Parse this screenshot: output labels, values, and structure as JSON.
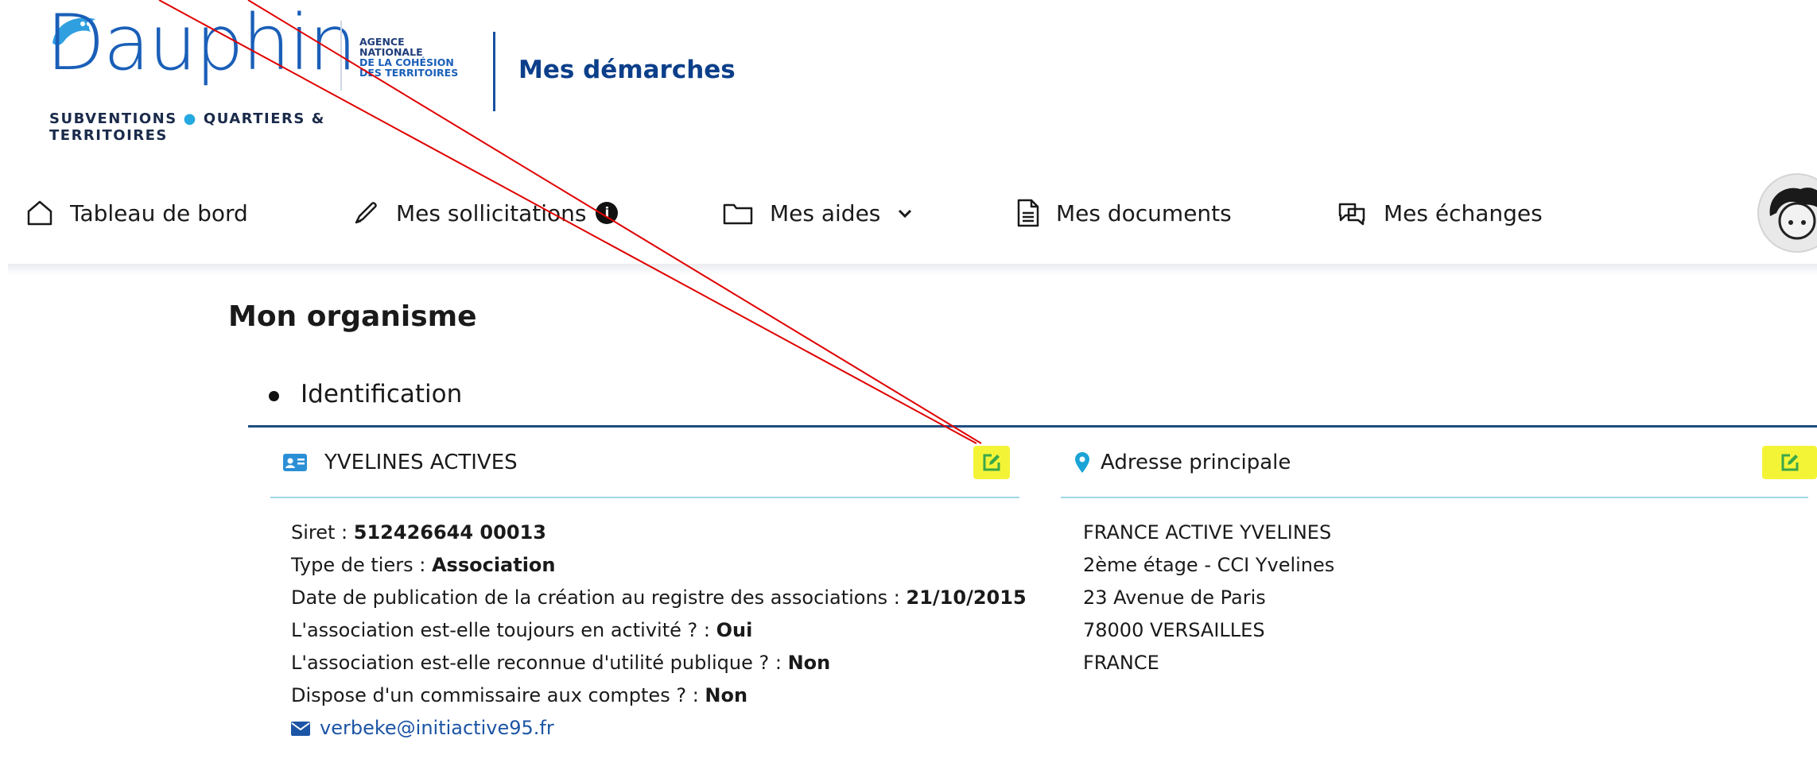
{
  "header": {
    "logo_text": "Dauphin",
    "tagline_left": "SUBVENTIONS",
    "tagline_right": "QUARTIERS & TERRITOIRES",
    "agency_lines": [
      "AGENCE",
      "NATIONALE",
      "DE LA COHÉSION",
      "DES TERRITOIRES"
    ],
    "app_title": "Mes démarches"
  },
  "nav": {
    "items": [
      {
        "label": "Tableau de bord",
        "icon": "home-icon"
      },
      {
        "label": "Mes sollicitations",
        "icon": "pen-icon",
        "badge": "i"
      },
      {
        "label": "Mes aides",
        "icon": "folder-icon",
        "dropdown": "chevron-down-icon"
      },
      {
        "label": "Mes documents",
        "icon": "document-icon"
      },
      {
        "label": "Mes échanges",
        "icon": "chat-icon"
      }
    ],
    "avatar": "user-avatar"
  },
  "page": {
    "title": "Mon organisme",
    "section": "Identification"
  },
  "identity_card": {
    "title": "YVELINES ACTIVES",
    "icon": "id-card-icon",
    "rows": [
      {
        "label": "Siret : ",
        "value": "512426644 00013"
      },
      {
        "label": "Type de tiers : ",
        "value": "Association"
      },
      {
        "label": "Date de publication de la création au registre des associations : ",
        "value": "21/10/2015"
      },
      {
        "label": "L'association est-elle toujours en activité ? : ",
        "value": "Oui"
      },
      {
        "label": "L'association est-elle reconnue d'utilité publique ? : ",
        "value": "Non"
      },
      {
        "label": "Dispose d'un commissaire aux comptes ? : ",
        "value": "Non"
      }
    ],
    "email": "verbeke@initiactive95.fr"
  },
  "address_card": {
    "title": "Adresse principale",
    "icon": "map-pin-icon",
    "lines": [
      "FRANCE ACTIVE YVELINES",
      "2ème étage - CCI Yvelines",
      "23 Avenue de Paris",
      "78000 VERSAILLES",
      "FRANCE"
    ]
  },
  "colors": {
    "brand_blue": "#0c3f8a",
    "accent_cyan": "#26a9e0",
    "highlight": "#f4f437",
    "edit_green": "#3aa84a",
    "annotation_red": "#e00000"
  }
}
